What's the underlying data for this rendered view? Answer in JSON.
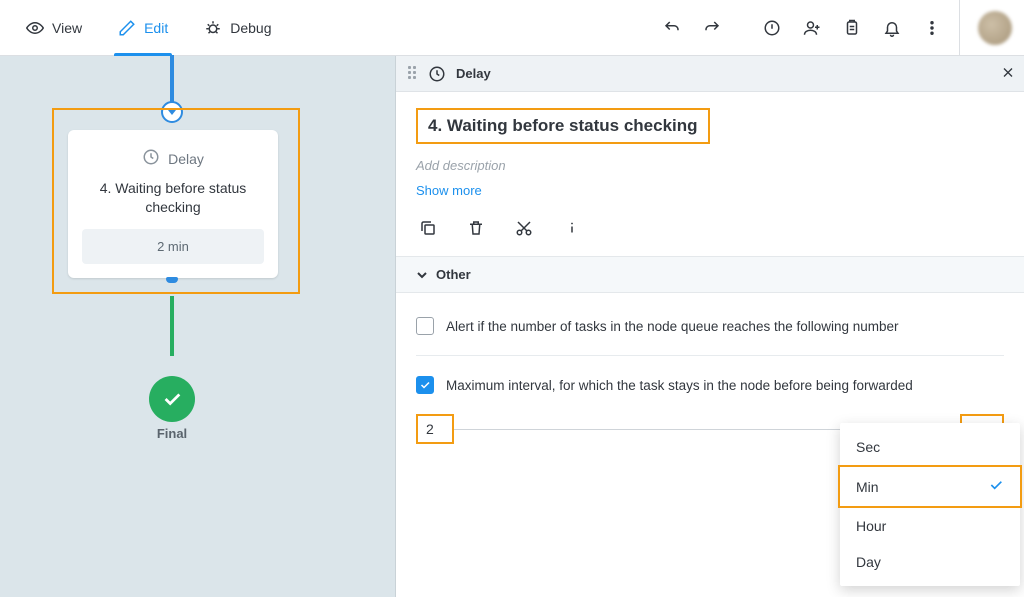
{
  "toolbar": {
    "view": "View",
    "edit": "Edit",
    "debug": "Debug"
  },
  "canvas": {
    "node": {
      "type_label": "Delay",
      "title": "4. Waiting before status checking",
      "badge": "2 min"
    },
    "final_label": "Final"
  },
  "panel": {
    "header_label": "Delay",
    "title": "4. Waiting before status checking",
    "desc_placeholder": "Add description",
    "show_more": "Show more",
    "section_other": "Other",
    "field_alert": "Alert if the number of tasks in the node queue reaches the following number",
    "field_max_interval": "Maximum interval, for which the task stays in the node before being forwarded",
    "interval_value": "2",
    "interval_unit": "Min",
    "unit_options": [
      "Sec",
      "Min",
      "Hour",
      "Day"
    ],
    "unit_selected_index": 1
  }
}
